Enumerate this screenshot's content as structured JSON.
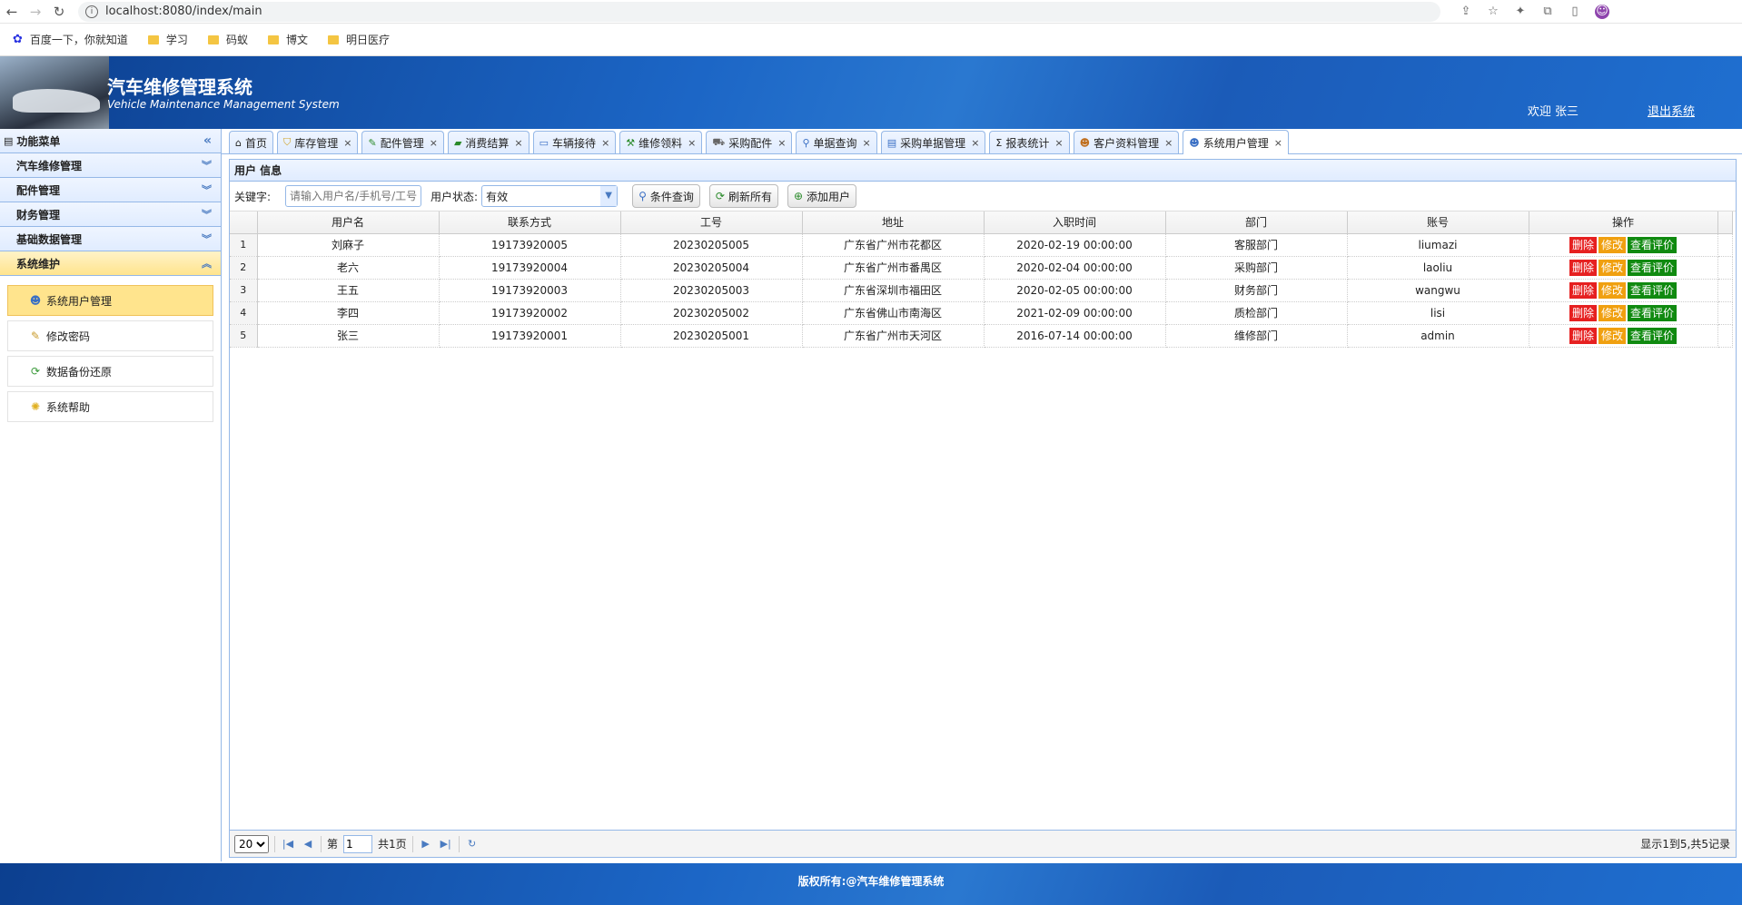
{
  "browser": {
    "url": "localhost:8080/index/main",
    "bookmarks": [
      "百度一下，你就知道",
      "学习",
      "码蚁",
      "博文",
      "明日医疗"
    ]
  },
  "header": {
    "title": "汽车维修管理系统",
    "subtitle": "Vehicle Maintenance Management System",
    "welcome": "欢迎 张三",
    "logout": "退出系统"
  },
  "sidebar": {
    "title": "功能菜单",
    "groups": [
      {
        "label": "汽车维修管理"
      },
      {
        "label": "配件管理"
      },
      {
        "label": "财务管理"
      },
      {
        "label": "基础数据管理"
      },
      {
        "label": "系统维护"
      }
    ],
    "items": [
      {
        "label": "系统用户管理",
        "icon": "user-icon"
      },
      {
        "label": "修改密码",
        "icon": "pencil-icon"
      },
      {
        "label": "数据备份还原",
        "icon": "refresh-icon"
      },
      {
        "label": "系统帮助",
        "icon": "lightbulb-icon"
      }
    ]
  },
  "tabs": [
    {
      "label": "首页",
      "icon": "home-icon"
    },
    {
      "label": "库存管理",
      "icon": "shield-icon"
    },
    {
      "label": "配件管理",
      "icon": "pencil-icon"
    },
    {
      "label": "消费结算",
      "icon": "money-icon"
    },
    {
      "label": "车辆接待",
      "icon": "car-icon"
    },
    {
      "label": "维修领料",
      "icon": "wrench-icon"
    },
    {
      "label": "采购配件",
      "icon": "cart-icon"
    },
    {
      "label": "单据查询",
      "icon": "search-icon"
    },
    {
      "label": "采购单据管理",
      "icon": "doc-icon"
    },
    {
      "label": "报表统计",
      "icon": "sigma-icon"
    },
    {
      "label": "客户资料管理",
      "icon": "users-icon"
    },
    {
      "label": "系统用户管理",
      "icon": "user-icon"
    }
  ],
  "panel": {
    "title": "用户 信息"
  },
  "toolbar": {
    "keyword_label": "关键字:",
    "keyword_placeholder": "请输入用户名/手机号/工号",
    "status_label": "用户状态:",
    "status_value": "有效",
    "search_btn": "条件查询",
    "refresh_btn": "刷新所有",
    "add_btn": "添加用户"
  },
  "table": {
    "columns": [
      "用户名",
      "联系方式",
      "工号",
      "地址",
      "入职时间",
      "部门",
      "账号",
      "操作"
    ],
    "rows": [
      {
        "n": "1",
        "name": "刘麻子",
        "phone": "19173920005",
        "no": "20230205005",
        "addr": "广东省广州市花都区",
        "date": "2020-02-19 00:00:00",
        "dept": "客服部门",
        "acct": "liumazi"
      },
      {
        "n": "2",
        "name": "老六",
        "phone": "19173920004",
        "no": "20230205004",
        "addr": "广东省广州市番禺区",
        "date": "2020-02-04 00:00:00",
        "dept": "采购部门",
        "acct": "laoliu"
      },
      {
        "n": "3",
        "name": "王五",
        "phone": "19173920003",
        "no": "20230205003",
        "addr": "广东省深圳市福田区",
        "date": "2020-02-05 00:00:00",
        "dept": "财务部门",
        "acct": "wangwu"
      },
      {
        "n": "4",
        "name": "李四",
        "phone": "19173920002",
        "no": "20230205002",
        "addr": "广东省佛山市南海区",
        "date": "2021-02-09 00:00:00",
        "dept": "质检部门",
        "acct": "lisi"
      },
      {
        "n": "5",
        "name": "张三",
        "phone": "19173920001",
        "no": "20230205001",
        "addr": "广东省广州市天河区",
        "date": "2016-07-14 00:00:00",
        "dept": "维修部门",
        "acct": "admin"
      }
    ],
    "actions": {
      "delete": "删除",
      "edit": "修改",
      "review": "查看评价"
    }
  },
  "pager": {
    "page_size": "20",
    "page_prefix": "第",
    "page_value": "1",
    "page_total": "共1页",
    "info": "显示1到5,共5记录"
  },
  "footer": "版权所有:@汽车维修管理系统"
}
